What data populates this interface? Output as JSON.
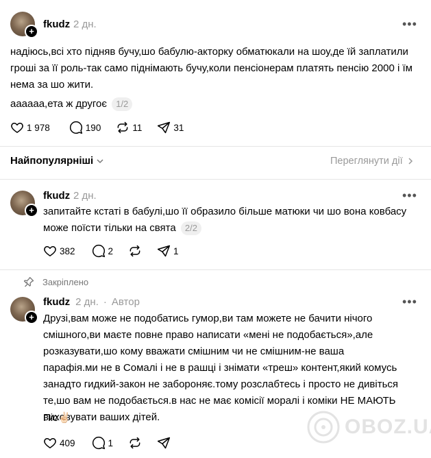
{
  "post": {
    "username": "fkudz",
    "time": "2 дн.",
    "text": "надіюсь,всі хто підняв бучу,шо бабулю-акторку обматюкали на шоу,де їй заплатили гроші за її роль-так само піднімають бучу,коли пенсіонерам платять пенсію 2000 і їм нема за шо жити.",
    "text2": "аааааа,ета ж другоє",
    "page": "1/2",
    "likes": "1 978",
    "comments": "190",
    "reposts": "11",
    "shares": "31"
  },
  "sort": {
    "label": "Найпопулярніші",
    "view_activity": "Переглянути дії"
  },
  "reply1": {
    "username": "fkudz",
    "time": "2 дн.",
    "text": "запитайте кстаті в бабулі,шо її образило більше матюки чи шо вона ковбасу може поїсти тільки на свята",
    "page": "2/2",
    "likes": "382",
    "comments": "2",
    "shares": "1"
  },
  "reply2": {
    "pinned": "Закріплено",
    "username": "fkudz",
    "time": "2 дн.",
    "author_sep": "·",
    "author": "Автор",
    "text": "Друзі,вам може не подобатись гумор,ви там можете не бачити нічого смішного,ви маєте повне право написати «мені не подобається»,але розказувати,шо кому вважати смішним чи не смішним-не ваша парафія.ми не в Сомалі і не в рашці і знімати «треш» контент,який комусь занадто гидкий-закон не забороняє.тому розслабтесь і просто не дивіться те,шо вам не подобається.в нас не має комісії моралі і коміки НЕ МАЮТЬ виховувати ваших дітей.",
    "sign": "Піс",
    "emoji": "✌🏻",
    "likes": "409",
    "comments": "1"
  },
  "watermark": "OBOZ.UA",
  "icons": [
    "plus-icon",
    "more-icon",
    "heart-icon",
    "comment-icon",
    "repost-icon",
    "share-icon",
    "chevron-down-icon",
    "chevron-right-icon",
    "pin-icon"
  ]
}
